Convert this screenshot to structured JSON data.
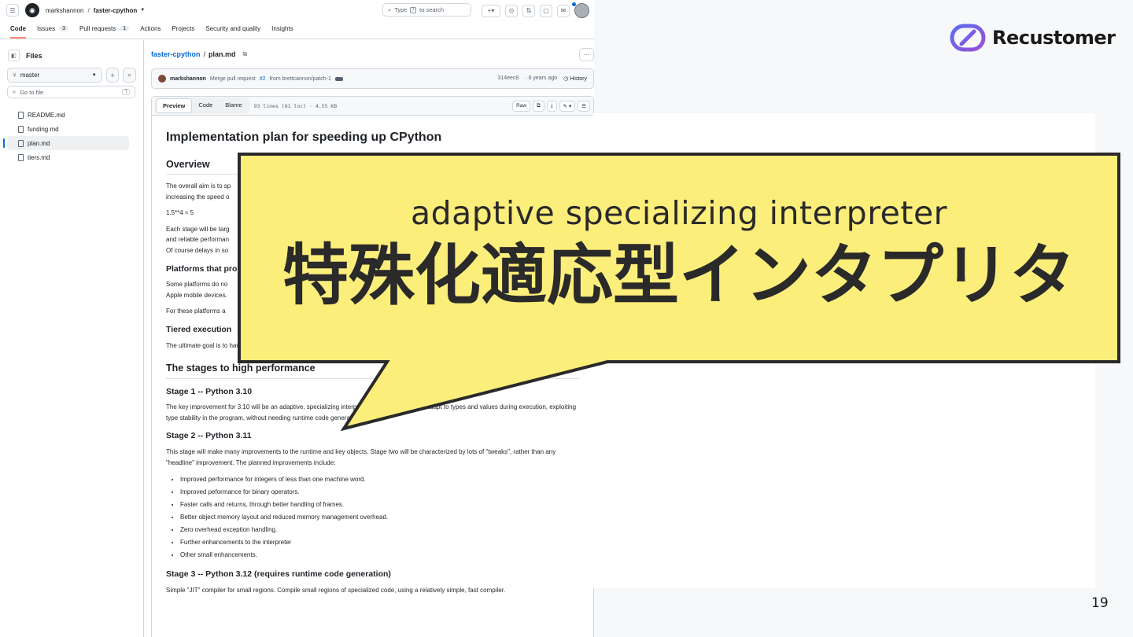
{
  "header": {
    "owner": "markshannon",
    "separator": "/",
    "repo": "faster-cpython",
    "search_prefix": "Type",
    "search_key": "/",
    "search_suffix": "to search"
  },
  "tabs": [
    {
      "label": "Code",
      "count": ""
    },
    {
      "label": "Issues",
      "count": "3"
    },
    {
      "label": "Pull requests",
      "count": "1"
    },
    {
      "label": "Actions",
      "count": ""
    },
    {
      "label": "Projects",
      "count": ""
    },
    {
      "label": "Security and quality",
      "count": ""
    },
    {
      "label": "Insights",
      "count": ""
    }
  ],
  "sidebar": {
    "title": "Files",
    "branch": "master",
    "goto_placeholder": "Go to file",
    "goto_key": "T",
    "files": [
      "README.md",
      "funding.md",
      "plan.md",
      "tiers.md"
    ]
  },
  "file_path": {
    "repo": "faster-cpython",
    "sep": "/",
    "file": "plan.md"
  },
  "commit": {
    "author": "markshannon",
    "msg_before": "Merge pull request",
    "pr": "#2",
    "msg_after": "from brettcannon/patch-1",
    "hash": "314eec8",
    "age": "· 6 years ago",
    "history": "History"
  },
  "file_bar": {
    "preview": "Preview",
    "code": "Code",
    "blame": "Blame",
    "meta": "93 lines (61 loc) · 4.55 KB",
    "raw": "Raw"
  },
  "doc": {
    "h1": "Implementation plan for speeding up CPython",
    "overview": "Overview",
    "p1a": "The overall aim is to sp",
    "p1b": "increasing the speed o",
    "formula": "1.5**4 ≈ 5",
    "p2a": "Each stage will be targ",
    "p2b": "and reliable performan",
    "p2c": "Of course delays in so",
    "platforms": "Platforms that pro",
    "p3a": "Some platforms do no",
    "p3b": "Apple mobile devices.",
    "p4": "For these platforms a",
    "tiered": "Tiered execution",
    "p5": "The ultimate goal is to have several tiers of execution, each tailo",
    "p5_end": "ns.",
    "stages": "The stages to high performance",
    "s1": "Stage 1 -- Python 3.10",
    "s1p": "The key improvement for 3.10 will be an adaptive, specializing interpreter. The interpreter will adapt to types and values during execution, exploiting type stability in the program, without needing runtime code generation.",
    "s2": "Stage 2 -- Python 3.11",
    "s2p": "This stage will make many improvements to the runtime and key objects. Stage two will be characterized by lots of \"tweaks\", rather than any \"headline\" improvement. The planned improvements include:",
    "bullets": [
      "Improved performance for integers of less than one machine word.",
      "Improved peformance for binary operators.",
      "Faster calls and returns, through better handling of frames.",
      "Better object memory layout and reduced memory management overhead.",
      "Zero overhead exception handling.",
      "Further enhancements to the interpreter",
      "Other small enhancements."
    ],
    "s3": "Stage 3 -- Python 3.12 (requires runtime code generation)",
    "s3p": "Simple \"JIT\" compiler for small regions. Compile small regions of specialized code, using a relatively simple, fast compiler."
  },
  "slide": {
    "logo": "Recustomer",
    "page_number": "19",
    "callout_en": "adaptive specializing interpreter",
    "callout_jp": "特殊化適応型インタプリタ",
    "callout_fill": "#fcee7a",
    "callout_stroke": "#2a2a2a"
  }
}
